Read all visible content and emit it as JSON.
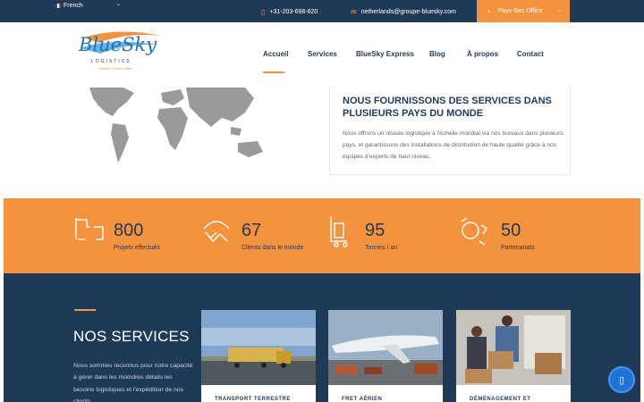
{
  "topbar": {
    "language": "French",
    "phone": "+31-203-698-620",
    "email": "netherlands@groupe-bluesky.com",
    "office": "Pays-Bas Office",
    "icons": {
      "flag": "france-flag-icon",
      "caret": "chevron-down-icon",
      "phone": "phone-icon",
      "email": "envelope-icon",
      "office": "globe-icon"
    }
  },
  "logo": {
    "word": "BlueSky",
    "sub": "LOGISTICS",
    "tagline": "Further, Faster, Safer"
  },
  "nav": {
    "items": [
      "Accueil",
      "Services",
      "BlueSky Express",
      "Blog",
      "À propos",
      "Contact"
    ],
    "active": "Accueil"
  },
  "intro": {
    "title": "NOUS FOURNISSONS DES SERVICES DANS PLUSIEURS PAYS DU MONDE",
    "text": "Nous offrons un réseau logistique à l'échelle mondial via nos bureaux dans plusieurs pays, et garantissons des installations de distribution de haute qualité grâce à nos équipés d'experts de haut niveau."
  },
  "stats": [
    {
      "value": "800",
      "label": "Projets effectués",
      "icon": "crane-icon"
    },
    {
      "value": "67",
      "label": "Clients dans le monde",
      "icon": "handshake-icon"
    },
    {
      "value": "95",
      "label": "Tonnes / an",
      "icon": "hand-truck-icon"
    },
    {
      "value": "50",
      "label": "Partenariats",
      "icon": "recycle-globe-icon"
    }
  ],
  "services": {
    "title": "NOS SERVICES",
    "text": "Nous sommes reconnus pour notre capacité à gérer dans les moindres détails les besoins logistiques et l'expédition de nos clients.",
    "cards": [
      {
        "label": "TRANSPORT TERRESTRE",
        "image": "truck-photo"
      },
      {
        "label": "FRET AÉRIEN",
        "image": "airplane-photo"
      },
      {
        "label": "DÉMÉNAGEMENT ET",
        "image": "moving-boxes-photo"
      }
    ]
  },
  "colors": {
    "navy": "#1f3a57",
    "orange": "#f5923e",
    "chat": "#1e73d8"
  }
}
